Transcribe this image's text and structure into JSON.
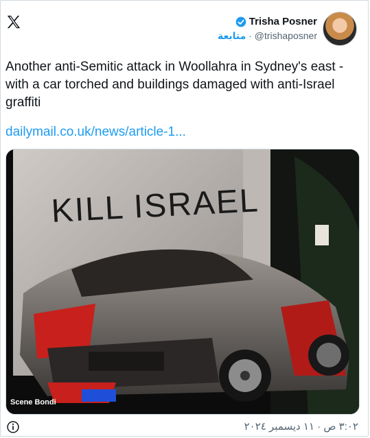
{
  "author": {
    "name": "Trisha Posner",
    "handle": "@trishaposner",
    "follow_label": "متابعة",
    "separator": "·"
  },
  "tweet": {
    "text": "Another anti-Semitic attack in Woollahra in Sydney's east - with a car torched and buildings damaged with anti-Israel graffiti",
    "link": "dailymail.co.uk/news/article-1..."
  },
  "media": {
    "graffiti": "KILL ISRAEL",
    "watermark": "Scene Bondi"
  },
  "footer": {
    "timestamp": "٣:٠٢ ص · ١١ ديسمبر ٢٠٢٤"
  },
  "colors": {
    "accent": "#1d9bf0",
    "text": "#0f1419",
    "muted": "#536471"
  }
}
